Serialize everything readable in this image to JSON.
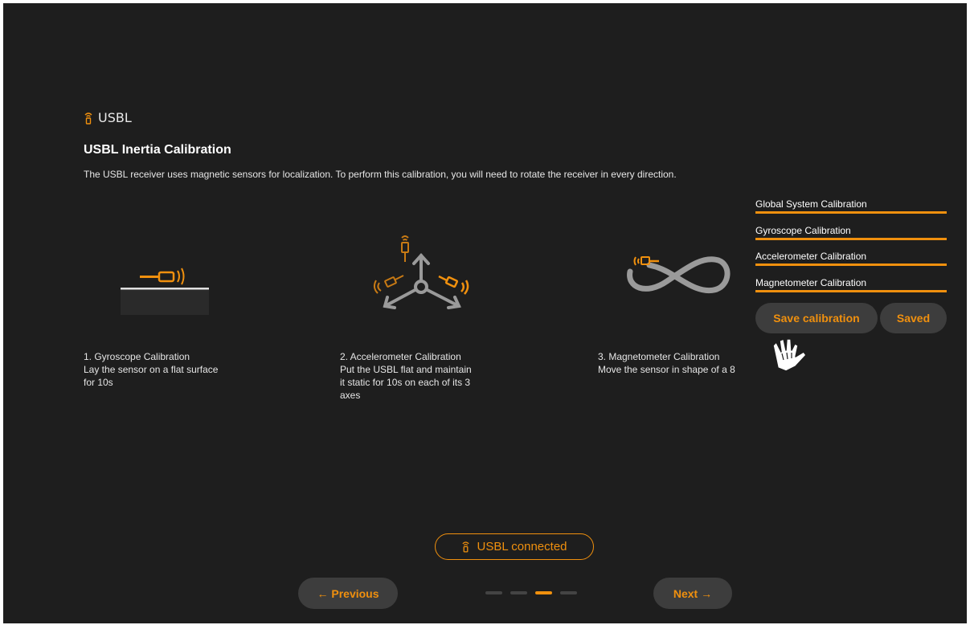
{
  "header": {
    "icon": "usbl-device-icon",
    "label": "USBL"
  },
  "page": {
    "title": "USBL Inertia Calibration",
    "description": "The USBL receiver uses magnetic sensors for localization. To perform this calibration, you will need to rotate the receiver in every direction."
  },
  "steps": [
    {
      "title": "1. Gyroscope Calibration",
      "lines": [
        "Lay the sensor on a flat surface",
        "for 10s"
      ],
      "icon": "gyroscope-flat-surface-icon"
    },
    {
      "title": "2. Accelerometer Calibration",
      "lines": [
        "Put the USBL flat and maintain",
        "it static for 10s on each of its 3",
        "axes"
      ],
      "icon": "accelerometer-axes-icon"
    },
    {
      "title": "3. Magnetometer Calibration",
      "lines": [
        "Move the sensor in shape of a 8"
      ],
      "icon": "magnetometer-figure-eight-icon"
    }
  ],
  "calibrations": [
    {
      "label": "Global System Calibration",
      "progress": 1.0
    },
    {
      "label": "Gyroscope Calibration",
      "progress": 1.0
    },
    {
      "label": "Accelerometer Calibration",
      "progress": 1.0
    },
    {
      "label": "Magnetometer Calibration",
      "progress": 1.0
    }
  ],
  "actions": {
    "save_label": "Save calibration",
    "saved_label": "Saved"
  },
  "status": {
    "label": "USBL connected",
    "icon": "usbl-device-icon"
  },
  "nav": {
    "previous_label": "← Previous",
    "next_label": "Next →",
    "page_count": 4,
    "current_page": 3
  },
  "colors": {
    "accent": "#f0900e",
    "background": "#1e1e1e",
    "button": "#3d3d3d"
  }
}
